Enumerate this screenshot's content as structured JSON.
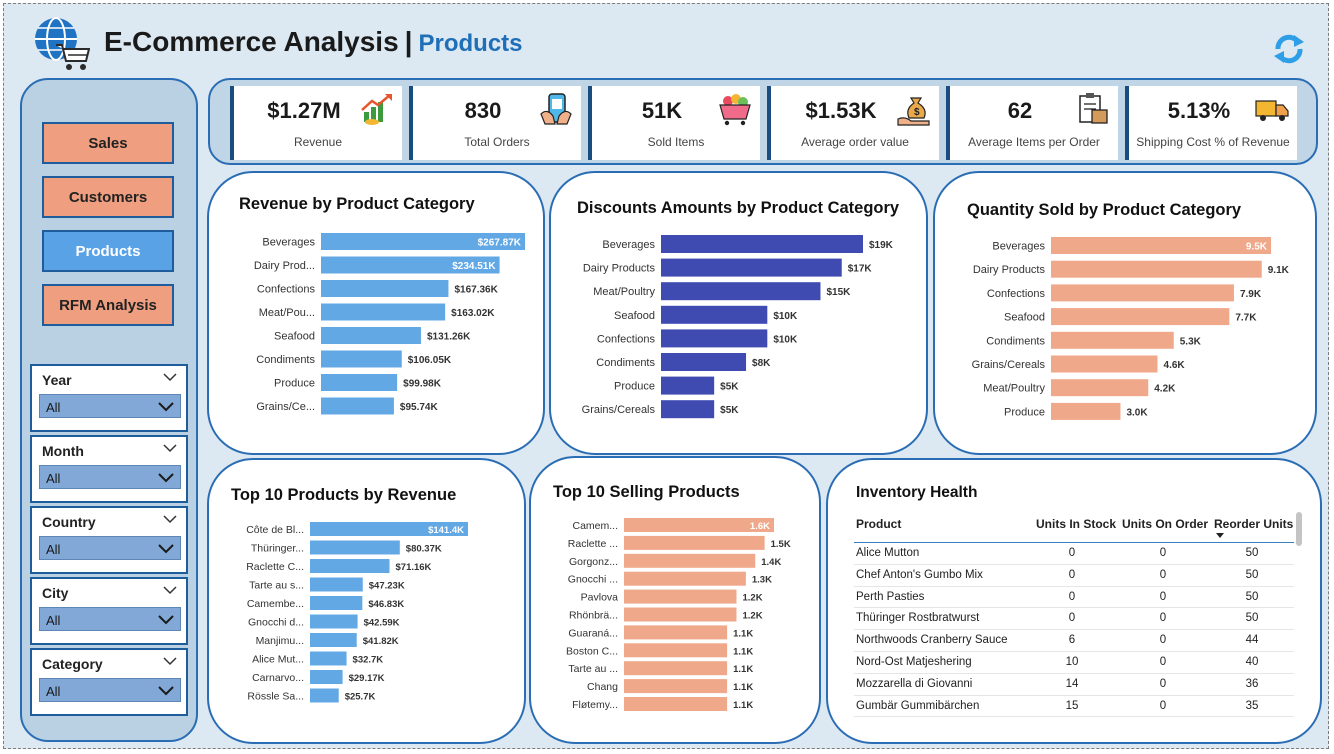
{
  "header": {
    "title": "E-Commerce Analysis",
    "separator": "|",
    "subtitle": "Products",
    "logo_icon": "globe-cart-icon",
    "refresh_icon": "refresh-icon"
  },
  "colors": {
    "accent": "#2a6db4",
    "nav_active": "#5aa2e6",
    "nav_inactive": "#ef9f80",
    "bar_blue": "#62a8e5",
    "bar_navy": "#3f4bb0",
    "bar_salmon": "#f0a88a"
  },
  "nav": [
    {
      "label": "Sales",
      "active": false
    },
    {
      "label": "Customers",
      "active": false
    },
    {
      "label": "Products",
      "active": true
    },
    {
      "label": "RFM Analysis",
      "active": false
    }
  ],
  "filters": [
    {
      "label": "Year",
      "value": "All"
    },
    {
      "label": "Month",
      "value": "All"
    },
    {
      "label": "Country",
      "value": "All"
    },
    {
      "label": "City",
      "value": "All"
    },
    {
      "label": "Category",
      "value": "All"
    }
  ],
  "kpis": [
    {
      "value": "$1.27M",
      "label": "Revenue",
      "icon": "revenue-growth-icon"
    },
    {
      "value": "830",
      "label": "Total Orders",
      "icon": "phone-order-icon"
    },
    {
      "value": "51K",
      "label": "Sold Items",
      "icon": "shopping-basket-icon"
    },
    {
      "value": "$1.53K",
      "label": "Average order value",
      "icon": "money-bag-icon"
    },
    {
      "value": "62",
      "label": "Average Items per Order",
      "icon": "clipboard-box-icon"
    },
    {
      "value": "5.13%",
      "label": "Shipping Cost % of Revenue",
      "icon": "delivery-truck-icon"
    }
  ],
  "chart_data": [
    {
      "type": "bar",
      "orientation": "horizontal",
      "title": "Revenue by Product Category",
      "categories": [
        "Beverages",
        "Dairy Prod...",
        "Confections",
        "Meat/Pou...",
        "Seafood",
        "Condiments",
        "Produce",
        "Grains/Ce..."
      ],
      "values": [
        267870,
        234510,
        167360,
        163020,
        131260,
        106050,
        99980,
        95740
      ],
      "labels": [
        "$267.87K",
        "$234.51K",
        "$167.36K",
        "$163.02K",
        "$131.26K",
        "$106.05K",
        "$99.98K",
        "$95.74K"
      ],
      "color": "#62a8e5",
      "grid": false
    },
    {
      "type": "bar",
      "orientation": "horizontal",
      "title": "Discounts Amounts by Product Category",
      "categories": [
        "Beverages",
        "Dairy Products",
        "Meat/Poultry",
        "Seafood",
        "Confections",
        "Condiments",
        "Produce",
        "Grains/Cereals"
      ],
      "values": [
        19000,
        17000,
        15000,
        10000,
        10000,
        8000,
        5000,
        5000
      ],
      "labels": [
        "$19K",
        "$17K",
        "$15K",
        "$10K",
        "$10K",
        "$8K",
        "$5K",
        "$5K"
      ],
      "color": "#3f4bb0",
      "grid": false
    },
    {
      "type": "bar",
      "orientation": "horizontal",
      "title": "Quantity Sold by Product Category",
      "categories": [
        "Beverages",
        "Dairy Products",
        "Confections",
        "Seafood",
        "Condiments",
        "Grains/Cereals",
        "Meat/Poultry",
        "Produce"
      ],
      "values": [
        9500,
        9100,
        7900,
        7700,
        5300,
        4600,
        4200,
        3000
      ],
      "labels": [
        "9.5K",
        "9.1K",
        "7.9K",
        "7.7K",
        "5.3K",
        "4.6K",
        "4.2K",
        "3.0K"
      ],
      "color": "#f0a88a",
      "grid": false
    },
    {
      "type": "bar",
      "orientation": "horizontal",
      "title": "Top 10 Products by Revenue",
      "categories": [
        "Côte de Bl...",
        "Thüringer...",
        "Raclette C...",
        "Tarte au s...",
        "Camembe...",
        "Gnocchi d...",
        "Manjimu...",
        "Alice Mut...",
        "Carnarvo...",
        "Rössle Sa..."
      ],
      "values": [
        141400,
        80370,
        71160,
        47230,
        46830,
        42590,
        41820,
        32700,
        29170,
        25700
      ],
      "labels": [
        "$141.4K",
        "$80.37K",
        "$71.16K",
        "$47.23K",
        "$46.83K",
        "$42.59K",
        "$41.82K",
        "$32.7K",
        "$29.17K",
        "$25.7K"
      ],
      "color": "#62a8e5",
      "grid": false
    },
    {
      "type": "bar",
      "orientation": "horizontal",
      "title": "Top 10 Selling Products",
      "categories": [
        "Camem...",
        "Raclette ...",
        "Gorgonz...",
        "Gnocchi ...",
        "Pavlova",
        "Rhönbrä...",
        "Guaraná...",
        "Boston C...",
        "Tarte au ...",
        "Chang",
        "Fløtemy..."
      ],
      "values": [
        1600,
        1500,
        1400,
        1300,
        1200,
        1200,
        1100,
        1100,
        1100,
        1100,
        1100
      ],
      "labels": [
        "1.6K",
        "1.5K",
        "1.4K",
        "1.3K",
        "1.2K",
        "1.2K",
        "1.1K",
        "1.1K",
        "1.1K",
        "1.1K",
        "1.1K"
      ],
      "color": "#f0a88a",
      "grid": false
    }
  ],
  "inventory": {
    "title": "Inventory Health",
    "columns": [
      "Product",
      "Units In Stock",
      "Units On Order",
      "Reorder Units"
    ],
    "rows": [
      [
        "Alice Mutton",
        "0",
        "0",
        "50"
      ],
      [
        "Chef Anton's Gumbo Mix",
        "0",
        "0",
        "50"
      ],
      [
        "Perth Pasties",
        "0",
        "0",
        "50"
      ],
      [
        "Thüringer Rostbratwurst",
        "0",
        "0",
        "50"
      ],
      [
        "Northwoods Cranberry Sauce",
        "6",
        "0",
        "44"
      ],
      [
        "Nord-Ost Matjeshering",
        "10",
        "0",
        "40"
      ],
      [
        "Mozzarella di Giovanni",
        "14",
        "0",
        "36"
      ],
      [
        "Gumbär Gummibärchen",
        "15",
        "0",
        "35"
      ]
    ]
  }
}
